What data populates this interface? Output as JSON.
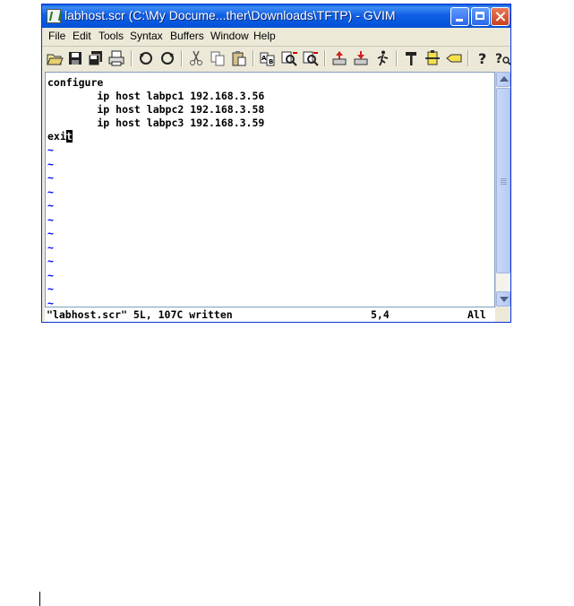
{
  "window": {
    "title": "labhost.scr (C:\\My Docume...ther\\Downloads\\TFTP) - GVIM"
  },
  "menu": [
    "File",
    "Edit",
    "Tools",
    "Syntax",
    "Buffers",
    "Window",
    "Help"
  ],
  "toolbar": {
    "icons": [
      "open-icon",
      "save-icon",
      "save-all-icon",
      "print-icon",
      "undo-icon",
      "redo-icon",
      "cut-icon",
      "copy-icon",
      "paste-icon",
      "find-replace-icon",
      "find-next-icon",
      "find-prev-icon",
      "load-session-icon",
      "save-session-icon",
      "run-script-icon",
      "make-icon",
      "shell-icon",
      "tag-icon",
      "help-icon",
      "find-help-icon"
    ]
  },
  "editor": {
    "lines": [
      "configure",
      "        ip host labpc1 192.168.3.56",
      "        ip host labpc2 192.168.3.58",
      "        ip host labpc3 192.168.3.59"
    ],
    "last_line_before_cursor": "exi",
    "cursor_char": "t",
    "tilde": "~",
    "tilde_count": 12
  },
  "status": {
    "message": "\"labhost.scr\" 5L, 107C written",
    "position": "5,4",
    "scroll": "All"
  },
  "colors": {
    "title_bar": "#0a5bd7",
    "tilde": "#0000ff",
    "cursor_bg": "#000000"
  }
}
